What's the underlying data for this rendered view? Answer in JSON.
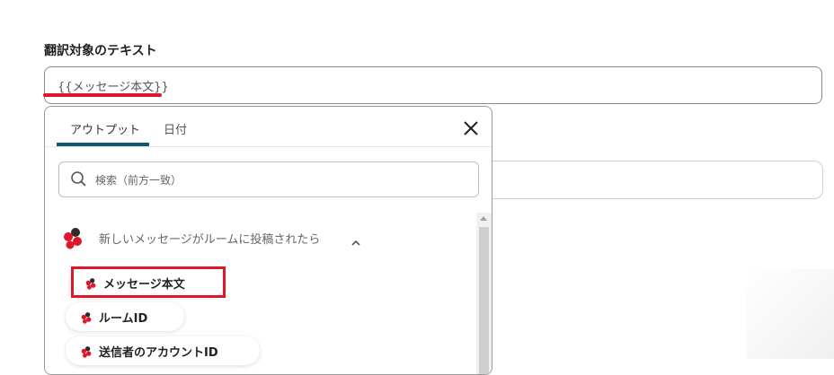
{
  "form": {
    "field_label": "翻訳対象のテキスト",
    "field_value": "{{メッセージ本文}}"
  },
  "dropdown": {
    "tabs": [
      {
        "label": "アウトプット",
        "active": true
      },
      {
        "label": "日付",
        "active": false
      }
    ],
    "close_icon": "close-icon",
    "search": {
      "placeholder": "検索（前方一致）",
      "value": ""
    },
    "group": {
      "label": "新しいメッセージがルームに投稿されたら",
      "expanded": true
    },
    "items": [
      {
        "label": "メッセージ本文",
        "highlighted": true
      },
      {
        "label": "ルームID",
        "highlighted": false
      },
      {
        "label": "送信者のアカウントID",
        "highlighted": false
      }
    ]
  },
  "colors": {
    "accent": "#0e5b70",
    "highlight": "#e0162b",
    "app_icon_red": "#e0162b",
    "app_icon_dark": "#2c2c2c"
  }
}
